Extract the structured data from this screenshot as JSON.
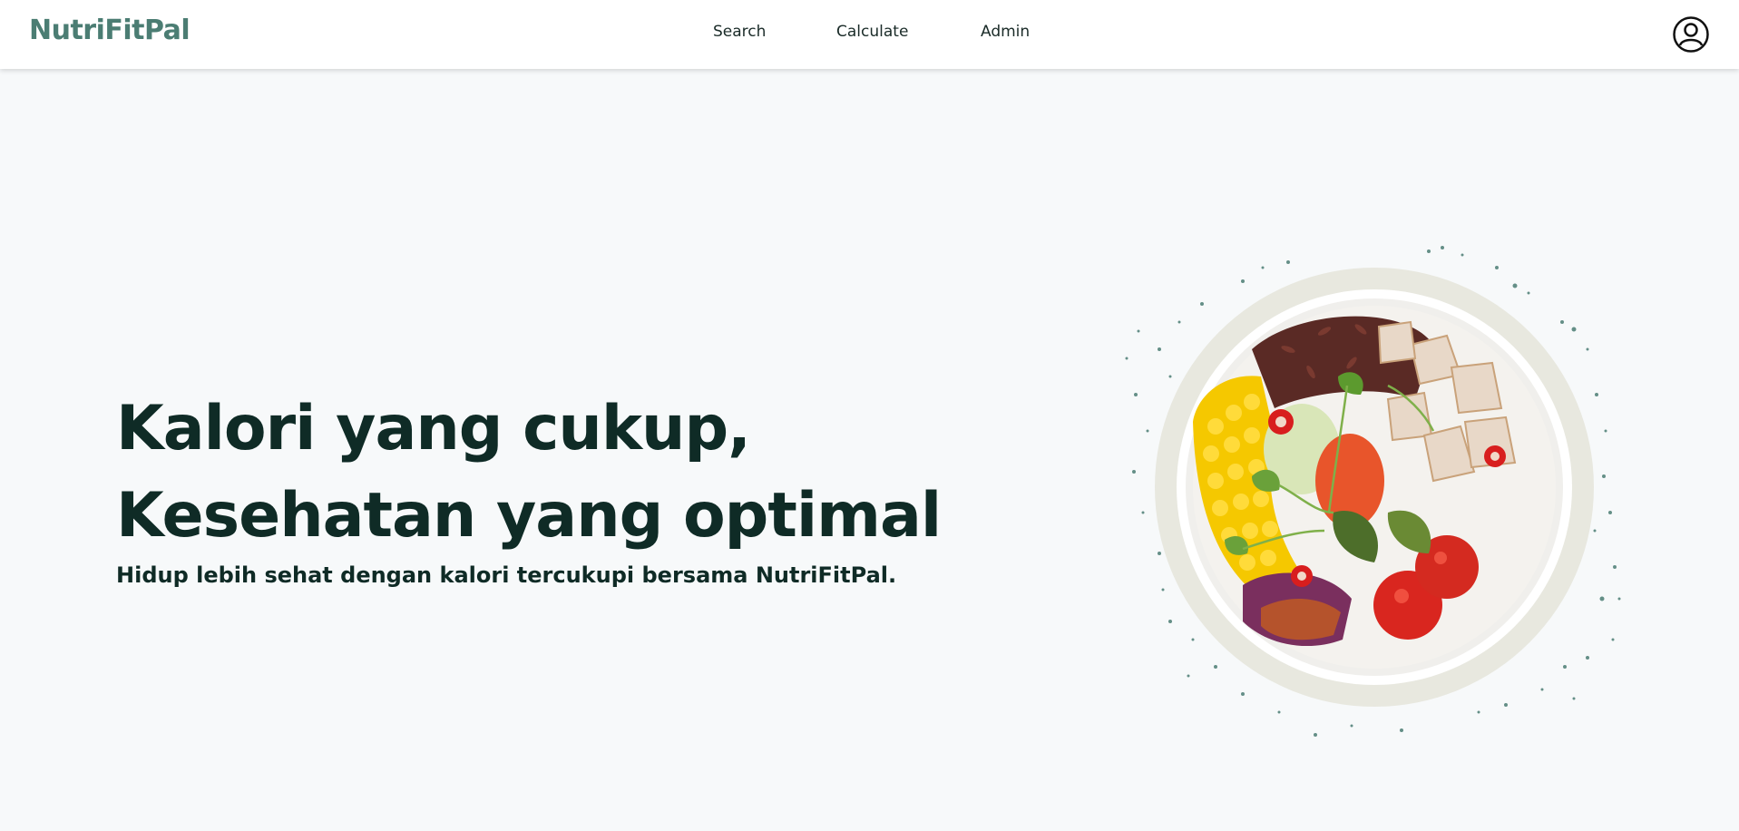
{
  "header": {
    "brand": "NutriFitPal",
    "nav": [
      {
        "label": "Search"
      },
      {
        "label": "Calculate"
      },
      {
        "label": "Admin"
      }
    ],
    "user_icon": "user-circle-icon"
  },
  "hero": {
    "title_line1": "Kalori yang cukup,",
    "title_line2": "Kesehatan yang optimal",
    "subtitle": "Hidup lebih sehat dengan kalori tercukupi bersama NutriFitPal.",
    "image": "salad-bowl-image"
  },
  "colors": {
    "brand": "#4b7d73",
    "text_dark": "#0f2b26",
    "background": "#f7f9fa"
  }
}
